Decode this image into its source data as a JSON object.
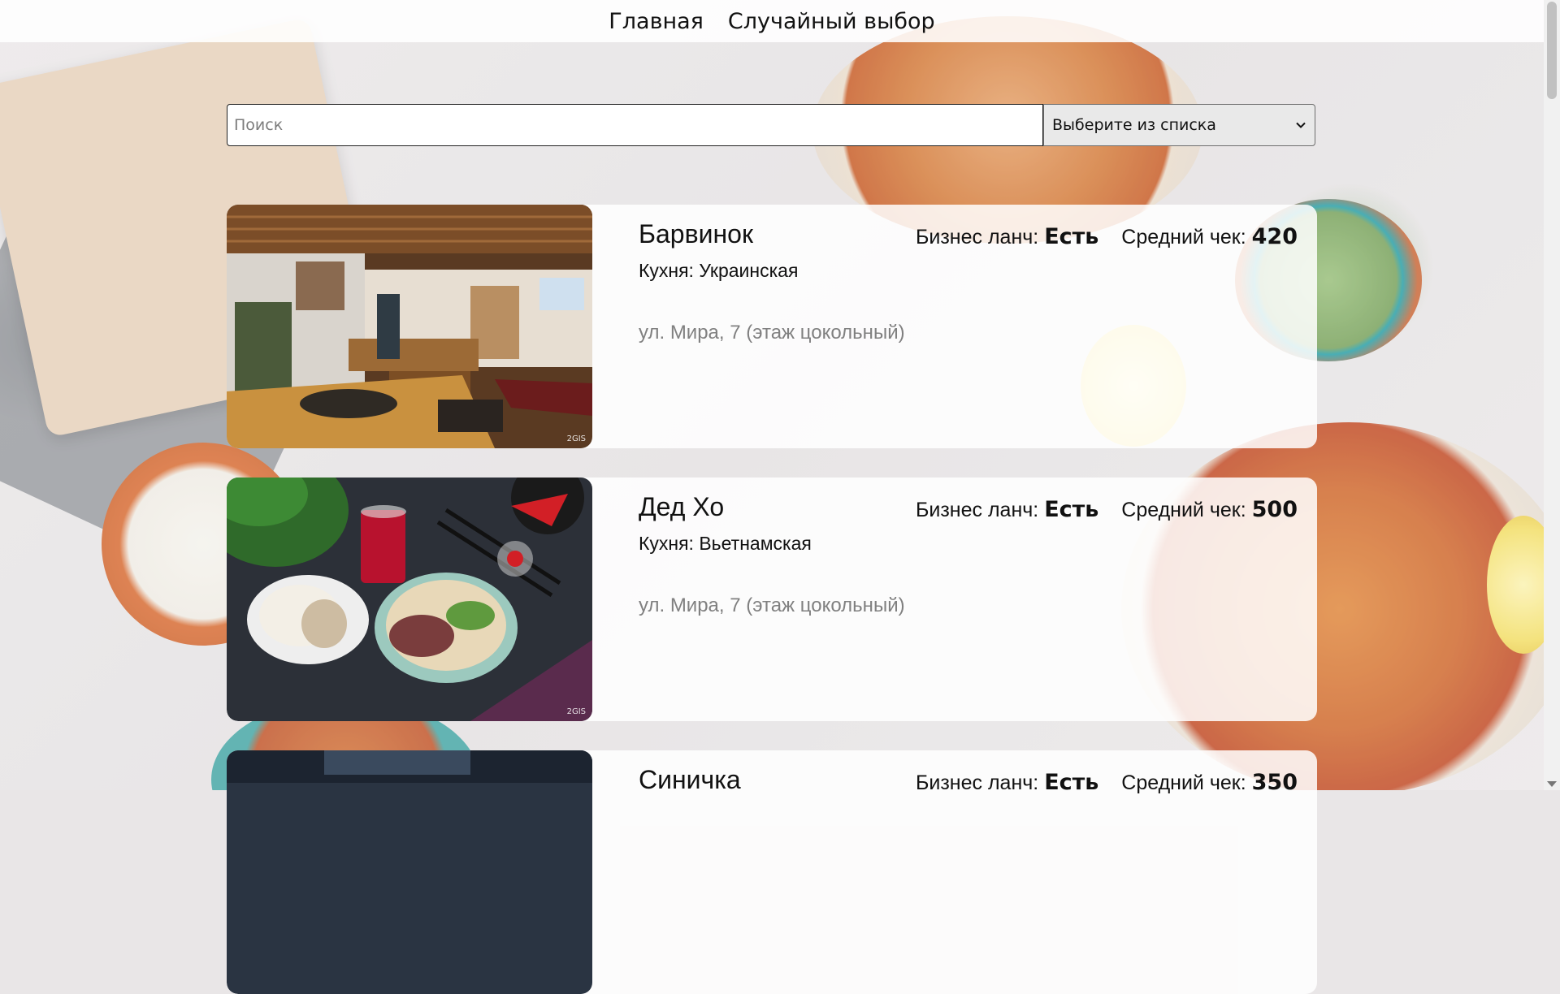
{
  "nav": {
    "home_label": "Главная",
    "random_label": "Случайный выбор"
  },
  "search": {
    "placeholder": "Поиск",
    "select_value": "Выберите из списка"
  },
  "labels": {
    "business_lunch": "Бизнес ланч:",
    "avg_check": "Средний чек:"
  },
  "restaurants": [
    {
      "name": "Барвинок",
      "cuisine": "Кухня: Украинская",
      "address": "ул. Мира, 7 (этаж цокольный)",
      "business_lunch": "Есть",
      "avg_check": "420",
      "photo_credit": "2GIS"
    },
    {
      "name": "Дед Хо",
      "cuisine": "Кухня: Вьетнамская",
      "address": "ул. Мира, 7 (этаж цокольный)",
      "business_lunch": "Есть",
      "avg_check": "500",
      "photo_credit": "2GIS"
    },
    {
      "name": "Синичка",
      "business_lunch": "Есть",
      "avg_check": "350"
    }
  ]
}
